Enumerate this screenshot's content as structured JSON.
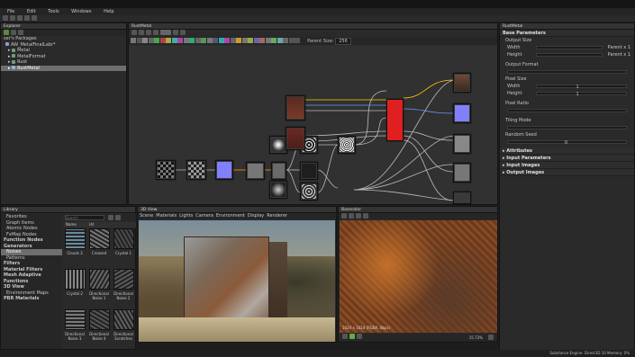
{
  "menu": [
    "File",
    "Edit",
    "Tools",
    "Windows",
    "Help"
  ],
  "explorer": {
    "title": "Explorer",
    "root": "ser's Packages",
    "package": "AW_MetalFinalLabr*",
    "items": [
      "Metal",
      "MetalFormat",
      "Rust",
      "RustMetal"
    ]
  },
  "graph": {
    "tab": "RustMetal",
    "parent_size_label": "Parent Size:",
    "parent_size_value": "256"
  },
  "library": {
    "title": "Library",
    "search_placeholder": "Search",
    "col_name": "Name",
    "col_url": "Url",
    "categories": [
      {
        "label": "Favorites",
        "bold": false,
        "sel": false
      },
      {
        "label": "Graph Items",
        "bold": false,
        "sel": false
      },
      {
        "label": "Atomic Nodes",
        "bold": false,
        "sel": false
      },
      {
        "label": "FxMap Nodes",
        "bold": false,
        "sel": false
      },
      {
        "label": "Function Nodes",
        "bold": true,
        "sel": false
      },
      {
        "label": "Generators",
        "bold": true,
        "sel": false
      },
      {
        "label": "Noises",
        "bold": false,
        "sel": true
      },
      {
        "label": "Patterns",
        "bold": false,
        "sel": false
      },
      {
        "label": "Filters",
        "bold": true,
        "sel": false
      },
      {
        "label": "Material Filters",
        "bold": true,
        "sel": false
      },
      {
        "label": "Mesh Adaptive",
        "bold": true,
        "sel": false
      },
      {
        "label": "Functions",
        "bold": true,
        "sel": false
      },
      {
        "label": "3D View",
        "bold": true,
        "sel": false
      },
      {
        "label": "Environment Maps",
        "bold": false,
        "sel": false
      },
      {
        "label": "PBR Materials",
        "bold": true,
        "sel": false
      }
    ],
    "thumbs": [
      "Clouds 3",
      "Creased",
      "Crystal 1",
      "Crystal 2",
      "Directional Noise 1",
      "Directional Noise 2",
      "Directional Noise 3",
      "Directional Noise 4",
      "Directional Scratches"
    ]
  },
  "view3d": {
    "title": "3D View",
    "menu": [
      "Scene",
      "Materials",
      "Lights",
      "Camera",
      "Environment",
      "Display",
      "Renderer"
    ]
  },
  "view2d": {
    "title": "Basecolor",
    "info": "1024 x 1024 (RGBA, 8bpc)",
    "zoom": "15.73%"
  },
  "params": {
    "tab": "RustMetal",
    "base": "Base Parameters",
    "output_size": "Output Size",
    "width": "Width",
    "height": "Height",
    "parent_x1": "Parent x 1",
    "output_format": "Output Format",
    "pixel_size": "Pixel Size",
    "pixel_ratio": "Pixel Ratio",
    "tiling_mode": "Tiling Mode",
    "random_seed": "Random Seed",
    "seed_value": "0",
    "one": "1",
    "attributes": "Attributes",
    "input_params": "Input Parameters",
    "input_images": "Input Images",
    "output_images": "Output Images"
  },
  "status": "Substance Engine: Direct3D 10  Memory: 0%",
  "colors": {
    "accent": "#3b6ea5",
    "output_red": "#e02020",
    "normal_blue": "#8080ff"
  }
}
